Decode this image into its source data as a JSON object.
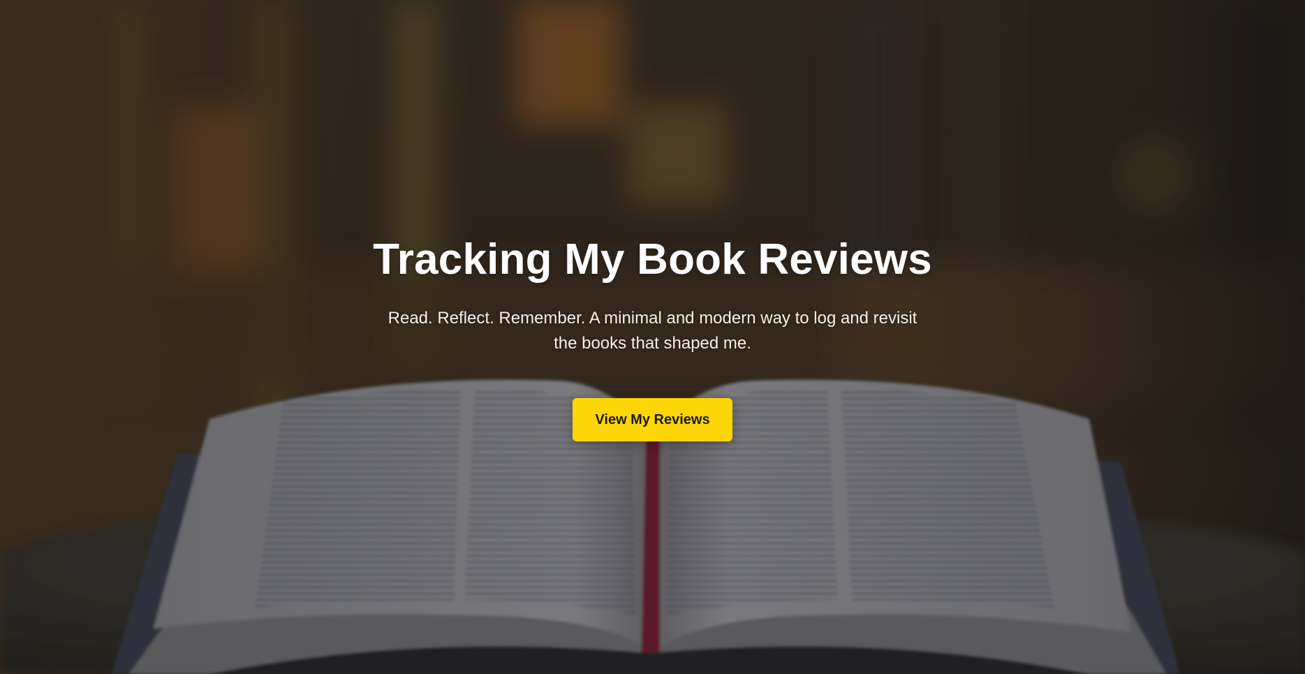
{
  "hero": {
    "title": "Tracking My Book Reviews",
    "subtitle": "Read. Reflect. Remember. A minimal and modern way to log and revisit the books that shaped me.",
    "cta_label": "View My Reviews"
  },
  "colors": {
    "accent": "#fed607",
    "title_text": "#ffffff",
    "subtitle_text": "#f4f1ea",
    "cta_text": "#1c1a14"
  },
  "background": {
    "image": "blurred-forest-with-open-book"
  }
}
